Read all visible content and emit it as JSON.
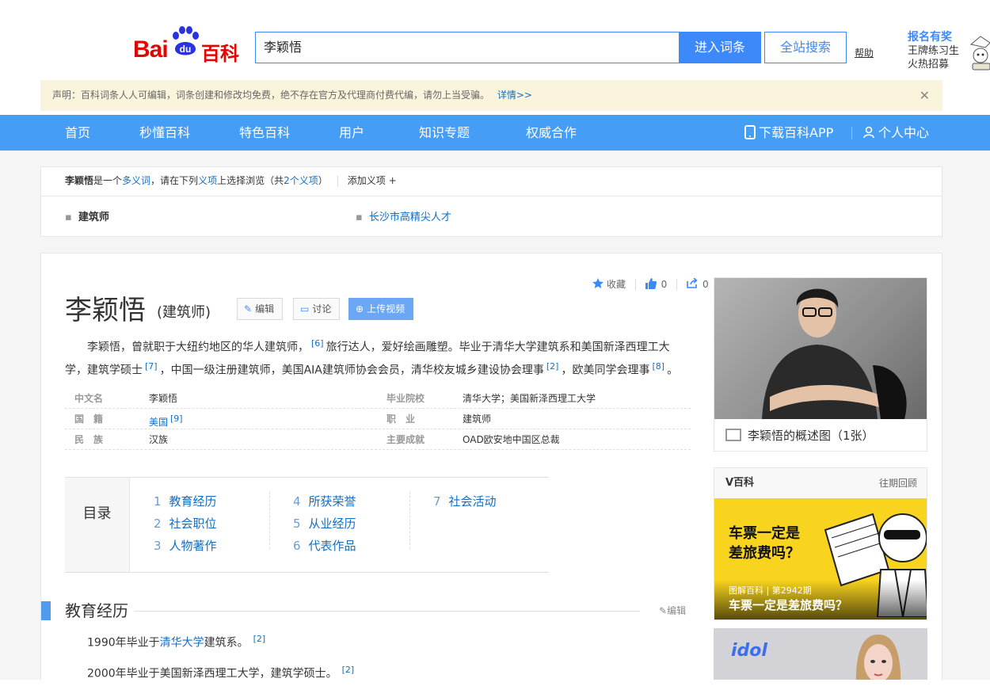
{
  "header": {
    "search_value": "李颖悟",
    "enter_button": "进入词条",
    "all_search_button": "全站搜索",
    "help_link": "帮助",
    "promo_title": "报名有奖",
    "promo_line1": "王牌练习生",
    "promo_line2": "火热招募"
  },
  "logo": {
    "bai": "Bai",
    "du": "du",
    "baike": "百科"
  },
  "notice": {
    "text": "声明：百科词条人人可编辑，词条创建和修改均免费，绝不存在官方及代理商付费代编，请勿上当受骗。",
    "more": "详情>>",
    "close": "✕"
  },
  "nav": {
    "items": [
      "首页",
      "秒懂百科",
      "特色百科",
      "用户",
      "知识专题",
      "权威合作"
    ],
    "download_app": "下载百科APP",
    "user_center": "个人中心"
  },
  "polysemant": {
    "term": "李颖悟",
    "t1": "是一个",
    "t2": "多义词",
    "t3": "，请在下列",
    "t4": "义项",
    "t5": "上选择浏览（共",
    "t6": "2个义项",
    "t7": "）",
    "add": "添加义项",
    "plus": "+",
    "options": [
      "建筑师",
      "长沙市高精尖人才"
    ]
  },
  "toolbar": {
    "favorite": "收藏",
    "like_count": "0",
    "share_count": "0",
    "edit": "编辑",
    "discuss": "讨论",
    "upload_video": "上传视频"
  },
  "entry": {
    "title": "李颖悟",
    "subtitle": "(建筑师)"
  },
  "summary": {
    "s1": "李颖悟，曾就职于大纽约地区的华人建筑师，",
    "r1": "[6]",
    "s2": "旅行达人，爱好绘画雕塑。毕业于清华大学建筑系和美国新泽西理工大学，建筑学硕士",
    "r2": "[7]",
    "s3": "，中国一级注册建筑师，美国AIA建筑师协会会员，清华校友城乡建设协会理事",
    "r3": "[2]",
    "s4": "，欧美同学会理事",
    "r4": "[8]",
    "s5": "。"
  },
  "basic_info": {
    "left": [
      {
        "name": "中文名",
        "value": "李颖悟",
        "ref": ""
      },
      {
        "name": "国　籍",
        "value": "美国",
        "ref": "[9]"
      },
      {
        "name": "民　族",
        "value": "汉族",
        "ref": ""
      }
    ],
    "right": [
      {
        "name": "毕业院校",
        "value": "清华大学；美国新泽西理工大学"
      },
      {
        "name": "职　业",
        "value": "建筑师"
      },
      {
        "name": "主要成就",
        "value": "OAD欧安地中国区总裁"
      }
    ]
  },
  "catalog": {
    "label": "目录",
    "items": [
      {
        "num": "1",
        "text": "教育经历"
      },
      {
        "num": "2",
        "text": "社会职位"
      },
      {
        "num": "3",
        "text": "人物著作"
      },
      {
        "num": "4",
        "text": "所获荣誉"
      },
      {
        "num": "5",
        "text": "从业经历"
      },
      {
        "num": "6",
        "text": "代表作品"
      },
      {
        "num": "7",
        "text": "社会活动"
      }
    ]
  },
  "section": {
    "title": "教育经历",
    "edit": "编辑",
    "p1_pre": "1990年毕业于",
    "p1_link": "清华大学",
    "p1_post": "建筑系。",
    "p1_ref": "[2]",
    "p2": "2000年毕业于美国新泽西理工大学，建筑学硕士。",
    "p2_ref": "[2]"
  },
  "side": {
    "album_caption": "李颖悟的概述图（1张）",
    "vbaike_title": "V百科",
    "vbaike_history": "往期回顾",
    "poster_line1": "车票一定是",
    "poster_line2": "差旅费吗？",
    "poster_meta": "图解百科 | 第2942期",
    "poster_caption": "车票一定是差旅费吗？",
    "idol_logo": "idol"
  },
  "colors": {
    "brand_red": "#e10602",
    "nav_blue": "#459df5",
    "link_blue": "#136ec2",
    "accent_blue": "#3e89fa",
    "notice_bg": "#fbf4dc",
    "poster_yellow": "#f9d41e"
  },
  "icons": [
    "paw-logo-icon",
    "mobile-phone-icon",
    "user-icon",
    "star-icon",
    "thumb-up-icon",
    "share-icon",
    "pencil-icon",
    "chat-icon",
    "plus-circle-icon",
    "album-icon",
    "close-icon"
  ]
}
